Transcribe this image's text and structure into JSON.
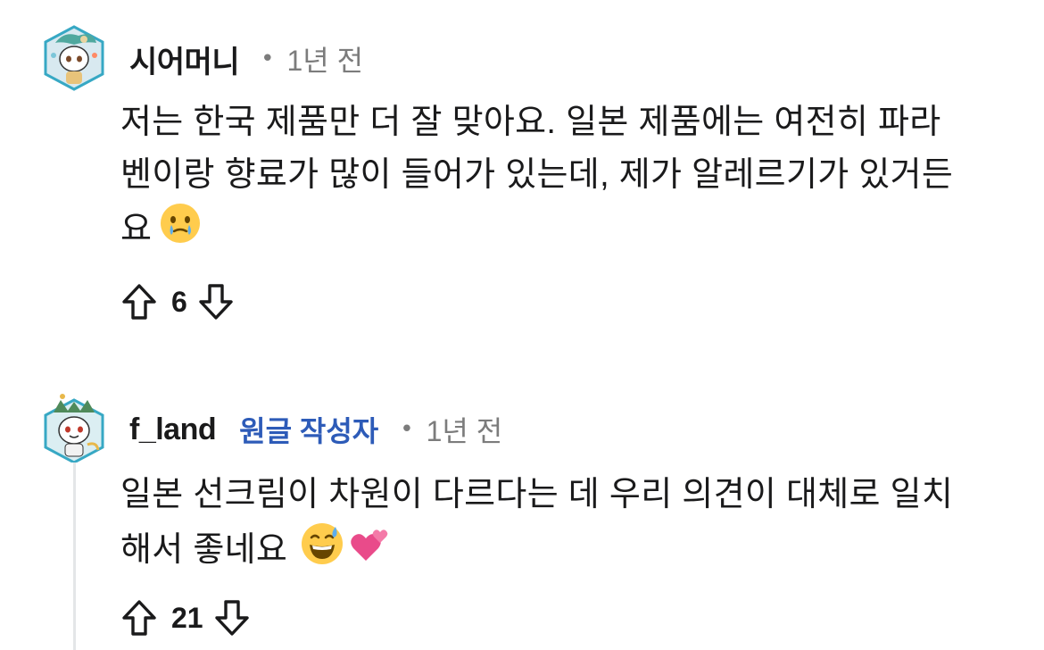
{
  "comments": [
    {
      "username": "시어머니",
      "op_badge": "",
      "separator": "•",
      "timestamp": "1년 전",
      "body_lines": [
        "저는 한국 제품만 더 잘 맞아요. 일본 제품에는 여전히 파라",
        "벤이랑 향료가 많이 들어가 있는데, 제가 알레르기가 있거든",
        "요"
      ],
      "emojis": [
        "face-holding-back-tears-emoji"
      ],
      "score": "6"
    },
    {
      "username": "f_land",
      "op_badge": "원글 작성자",
      "separator": "•",
      "timestamp": "1년 전",
      "body_lines": [
        "일본 선크림이 차원이 다르다는 데 우리 의견이 대체로 일치",
        "해서 좋네요"
      ],
      "emojis": [
        "grinning-face-with-sweat-emoji",
        "two-hearts-emoji"
      ],
      "score": "21"
    }
  ],
  "colors": {
    "text": "#1a1a1b",
    "meta": "#7c7c7c",
    "op_badge": "#2d5bb8",
    "thread_line": "#e4e6e8"
  }
}
